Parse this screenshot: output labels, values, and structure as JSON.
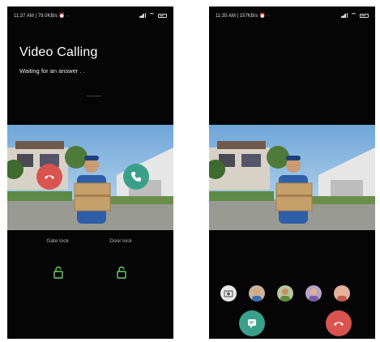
{
  "left_screen": {
    "status_time": "11:37 AM | 79.0KB/s",
    "status_extra": "⏰ ··",
    "title": "Video Calling",
    "subtitle": "Waiting for an answer . .",
    "decline_icon": "hangup-icon",
    "accept_icon": "phone-icon",
    "locks": [
      {
        "label": "Gate lock",
        "icon": "lock-icon"
      },
      {
        "label": "Door lock",
        "icon": "lock-icon"
      }
    ]
  },
  "right_screen": {
    "status_time": "11:35 AM | 157KB/s",
    "status_extra": "⏰ ··",
    "avatars": [
      "camera-icon",
      "avatar-1",
      "avatar-2",
      "avatar-3",
      "avatar-4"
    ],
    "message_icon": "chat-icon",
    "hangup_icon": "hangup-icon"
  },
  "colors": {
    "decline": "#d9534f",
    "accept": "#3aa08a",
    "lock_green": "#6fcf6a",
    "background": "#050505"
  }
}
